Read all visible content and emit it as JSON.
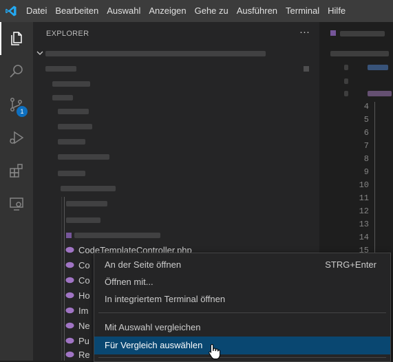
{
  "menubar": {
    "items": [
      "Datei",
      "Bearbeiten",
      "Auswahl",
      "Anzeigen",
      "Gehe zu",
      "Ausführen",
      "Terminal",
      "Hilfe"
    ]
  },
  "activitybar": {
    "icons": [
      "files-icon",
      "search-icon",
      "source-control-icon",
      "run-debug-icon",
      "extensions-icon",
      "remote-explorer-icon"
    ],
    "scm_badge": "1"
  },
  "sidebar": {
    "title": "EXPLORER",
    "more_label": "···",
    "visible_file": "CodeTemplateController.php",
    "truncated_files": [
      "Co",
      "Co",
      "Ho",
      "Im",
      "Ne",
      "Pu",
      "Re"
    ]
  },
  "editor": {
    "line_numbers": [
      "4",
      "5",
      "6",
      "7",
      "8",
      "9",
      "10",
      "11",
      "12",
      "13",
      "14",
      "15"
    ]
  },
  "context_menu": {
    "items": [
      {
        "label": "An der Seite öffnen",
        "shortcut": "STRG+Enter"
      },
      {
        "label": "Öffnen mit..."
      },
      {
        "label": "In integriertem Terminal öffnen"
      },
      {
        "label": "Mit Auswahl vergleichen"
      },
      {
        "label": "Für Vergleich auswählen"
      }
    ],
    "highlighted": "Für Vergleich auswählen"
  },
  "colors": {
    "accent": "#0e70c0",
    "highlight": "#094771",
    "php_icon": "#a074c4",
    "vscode_blue": "#23a9f2"
  }
}
